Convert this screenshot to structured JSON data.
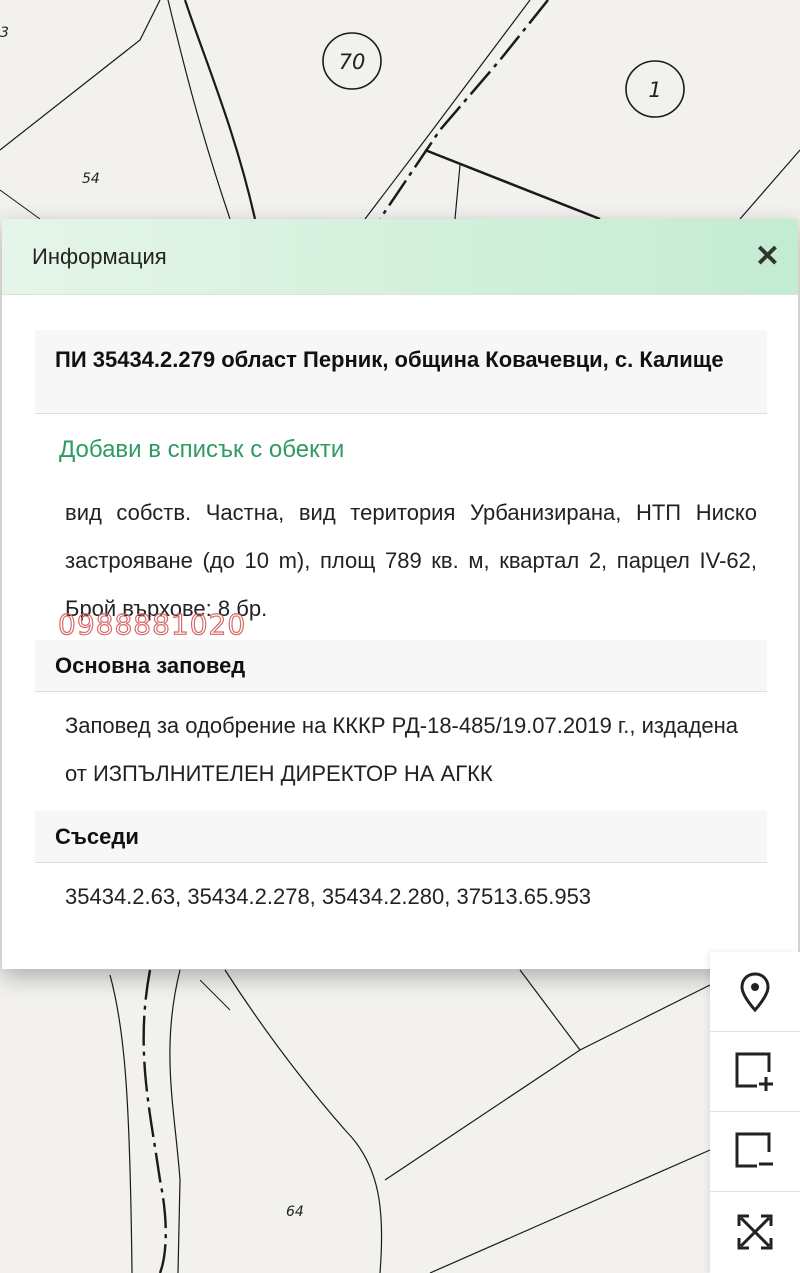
{
  "map": {
    "parcel_labels": [
      {
        "id": "p70",
        "text": "70"
      },
      {
        "id": "p1",
        "text": "1"
      }
    ],
    "lot_labels": [
      {
        "id": "l63",
        "text": "3"
      },
      {
        "id": "l54",
        "text": "54"
      },
      {
        "id": "l64",
        "text": "64"
      }
    ]
  },
  "info_panel": {
    "title": "Информация",
    "parcel_title": "ПИ 35434.2.279 област Перник, община Ковачевци, с. Калище",
    "add_to_list": "Добави в списък с обекти",
    "details": "вид собств. Частна, вид територия Урбанизирана, НТП Ниско застрояване (до 10 m), площ 789 кв. м, квартал 2, парцел IV-62, Брой върхове: 8 бр.",
    "watermark": "0988881020",
    "order_heading": "Основна заповед",
    "order_text": "Заповед за одобрение на КККР РД-18-485/19.07.2019 г., издадена от ИЗПЪЛНИТЕЛЕН ДИРЕКТОР НА АГКК",
    "neighbours_heading": "Съседи",
    "neighbours_text": "35434.2.63, 35434.2.278, 35434.2.280, 37513.65.953"
  },
  "toolbar": {
    "tools": [
      "location-pin-icon",
      "add-area-icon",
      "remove-area-icon",
      "fullscreen-icon"
    ]
  }
}
